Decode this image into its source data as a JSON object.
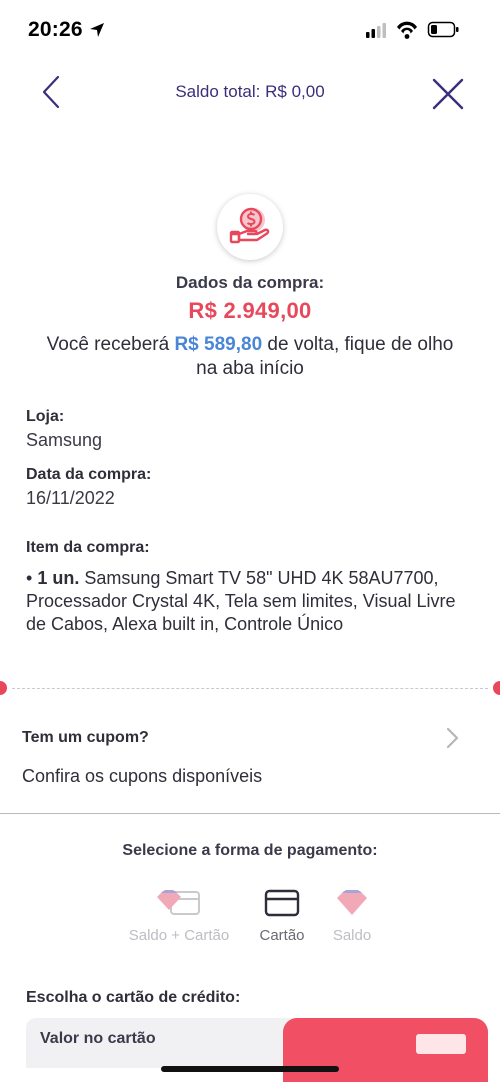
{
  "status_bar": {
    "time": "20:26"
  },
  "header": {
    "title": "Saldo total: R$ 0,00"
  },
  "purchase": {
    "heading": "Dados da compra:",
    "price": "R$ 2.949,00",
    "cashback_prefix": "Você receberá ",
    "cashback_amount": "R$ 589,80",
    "cashback_suffix": " de volta, fique de olho na aba início"
  },
  "store": {
    "label": "Loja:",
    "value": "Samsung"
  },
  "purchase_date": {
    "label": "Data da compra:",
    "value": "16/11/2022"
  },
  "item": {
    "label": "Item da compra:",
    "bullet": "• ",
    "quantity": "1 un.",
    "description": " Samsung Smart TV 58\" UHD 4K 58AU7700, Processador Crystal 4K, Tela sem limites, Visual Livre de Cabos, Alexa built in, Controle Único"
  },
  "coupon": {
    "title": "Tem um cupom?",
    "subtitle": "Confira os cupons disponíveis"
  },
  "payment": {
    "title": "Selecione a forma de pagamento:",
    "options": [
      {
        "label": "Saldo + Cartão",
        "icon": "balance-card-icon",
        "selected": false
      },
      {
        "label": "Cartão",
        "icon": "credit-card-icon",
        "selected": true
      },
      {
        "label": "Saldo",
        "icon": "balance-diamond-icon",
        "selected": false
      }
    ]
  },
  "credit_card": {
    "title": "Escolha o cartão de crédito:",
    "strip_text": "Valor no cartão"
  },
  "colors": {
    "accent_red": "#e8475c",
    "accent_blue": "#4a86d8",
    "header_purple": "#3a2f7a"
  }
}
